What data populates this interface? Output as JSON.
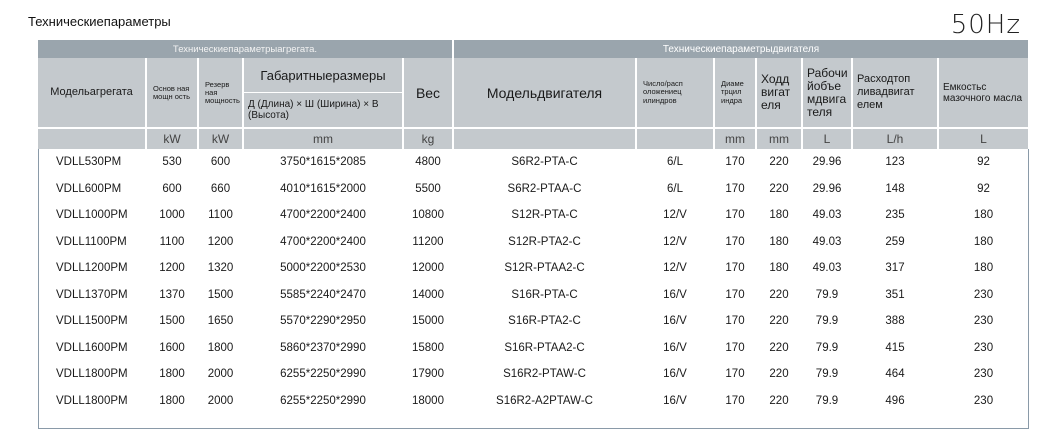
{
  "page": {
    "title": "Техническиепараметры",
    "frequency": "50Hz"
  },
  "table": {
    "group_headers": {
      "genset": "Техническиепараметрыагрегата.",
      "engine": "Техническиепараметрыдвигателя"
    },
    "headers": {
      "model": "Модельагрегата",
      "prime_power": "Основ ная мощн ость",
      "standby_power": "Резерв ная мощность",
      "dimensions": "Габаритныеразмеры",
      "dimensions_detail": "Д (Длина) × Ш (Ширина) × В (Высота)",
      "weight": "Вес",
      "engine_model": "Модельдвигателя",
      "cylinders": "Число/расп оложениец илиндров",
      "bore": "Диаме трцил индра",
      "stroke": "Ходд вигат еля",
      "displacement": "Рабочи йобъе мдвига теля",
      "fuel": "Расходтоп ливадвигат елем",
      "oil": "Емкостьс мазочного масла"
    },
    "units": {
      "prime_power": "kW",
      "standby_power": "kW",
      "dimensions": "mm",
      "weight": "kg",
      "bore": "mm",
      "stroke": "mm",
      "displacement": "L",
      "fuel": "L/h",
      "oil": "L"
    },
    "rows": [
      [
        "VDLL530PM",
        "530",
        "600",
        "3750*1615*2085",
        "4800",
        "S6R2-PTA-C",
        "6/L",
        "170",
        "220",
        "29.96",
        "123",
        "92"
      ],
      [
        "VDLL600PM",
        "600",
        "660",
        "4010*1615*2000",
        "5500",
        "S6R2-PTAA-C",
        "6/L",
        "170",
        "220",
        "29.96",
        "148",
        "92"
      ],
      [
        "VDLL1000PM",
        "1000",
        "1100",
        "4700*2200*2400",
        "10800",
        "S12R-PTA-C",
        "12/V",
        "170",
        "180",
        "49.03",
        "235",
        "180"
      ],
      [
        "VDLL1100PM",
        "1100",
        "1200",
        "4700*2200*2400",
        "11200",
        "S12R-PTA2-C",
        "12/V",
        "170",
        "180",
        "49.03",
        "259",
        "180"
      ],
      [
        "VDLL1200PM",
        "1200",
        "1320",
        "5000*2200*2530",
        "12000",
        "S12R-PTAA2-C",
        "12/V",
        "170",
        "180",
        "49.03",
        "317",
        "180"
      ],
      [
        "VDLL1370PM",
        "1370",
        "1500",
        "5585*2240*2470",
        "14000",
        "S16R-PTA-C",
        "16/V",
        "170",
        "220",
        "79.9",
        "351",
        "230"
      ],
      [
        "VDLL1500PM",
        "1500",
        "1650",
        "5570*2290*2950",
        "15000",
        "S16R-PTA2-C",
        "16/V",
        "170",
        "220",
        "79.9",
        "388",
        "230"
      ],
      [
        "VDLL1600PM",
        "1600",
        "1800",
        "5860*2370*2990",
        "15800",
        "S16R-PTAA2-C",
        "16/V",
        "170",
        "220",
        "79.9",
        "415",
        "230"
      ],
      [
        "VDLL1800PM",
        "1800",
        "2000",
        "6255*2250*2990",
        "17900",
        "S16R2-PTAW-C",
        "16/V",
        "170",
        "220",
        "79.9",
        "464",
        "230"
      ],
      [
        "VDLL1800PM",
        "1800",
        "2000",
        "6255*2250*2990",
        "18000",
        "S16R2-A2PTAW-C",
        "16/V",
        "170",
        "220",
        "79.9",
        "496",
        "230"
      ]
    ]
  }
}
